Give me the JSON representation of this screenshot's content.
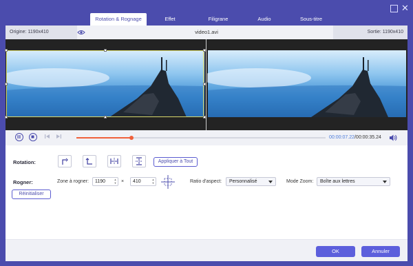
{
  "window": {
    "minimize_icon": "minimize-icon",
    "close_icon": "close-icon",
    "close_glyph": "✕"
  },
  "tabs": [
    {
      "label": "Rotation & Rognage",
      "active": true
    },
    {
      "label": "Effet",
      "active": false
    },
    {
      "label": "Filigrane",
      "active": false
    },
    {
      "label": "Audio",
      "active": false
    },
    {
      "label": "Sous-titre",
      "active": false
    }
  ],
  "preview": {
    "origin_label": "Origine: 1190x410",
    "file_name": "video1.avi",
    "output_label": "Sortie: 1190x410"
  },
  "playback": {
    "current_time": "00:00:07.22",
    "total_time": "/00:00:35.24",
    "progress": 0.22
  },
  "rotation": {
    "label": "Rotation:",
    "apply_all_label": "Appliquer à Tout"
  },
  "crop": {
    "label": "Rogner:",
    "zone_label": "Zone à rogner:",
    "width": "1190",
    "times_glyph": "×",
    "height": "410",
    "aspect_label": "Ratio d'aspect:",
    "aspect_value": "Personnalisé",
    "zoom_label": "Mode Zoom:",
    "zoom_value": "Boîte aux lettres",
    "reset_label": "Réinitialiser"
  },
  "footer": {
    "ok_label": "OK",
    "cancel_label": "Annuler"
  },
  "colors": {
    "accent": "#4b4cad",
    "button": "#5c5fdc",
    "progress": "#f0603a",
    "time_current": "#4b7bd9"
  }
}
